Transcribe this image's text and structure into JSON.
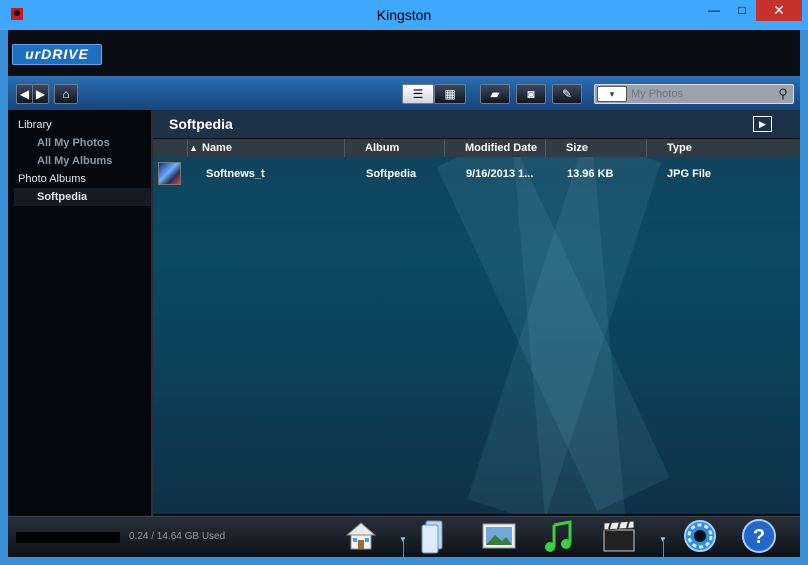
{
  "window": {
    "title": "Kingston",
    "minimize_glyph": "—",
    "maximize_glyph": "□",
    "close_glyph": "✕"
  },
  "app": {
    "logo_text": "urDRIVE"
  },
  "toolbar": {
    "search_placeholder": "My Photos",
    "search_type_glyph": "▾"
  },
  "sidebar": {
    "library_label": "Library",
    "all_photos_label": "All My Photos",
    "all_albums_label": "All My Albums",
    "albums_label": "Photo Albums",
    "album_item_label": "Softpedia"
  },
  "main": {
    "title": "Softpedia",
    "columns": {
      "name": "Name",
      "album": "Album",
      "modified": "Modified Date",
      "size": "Size",
      "type": "Type"
    },
    "rows": [
      {
        "name": "Softnews_t",
        "album": "Softpedia",
        "modified": "9/16/2013  1...",
        "size": "13.96 KB",
        "type": "JPG File"
      }
    ]
  },
  "status": {
    "storage_text": "0.24 / 14.64 GB Used"
  },
  "colors": {
    "title_bar": "#40a7ff",
    "close_button": "#c7312b",
    "panel_accent": "#0c4a63"
  }
}
